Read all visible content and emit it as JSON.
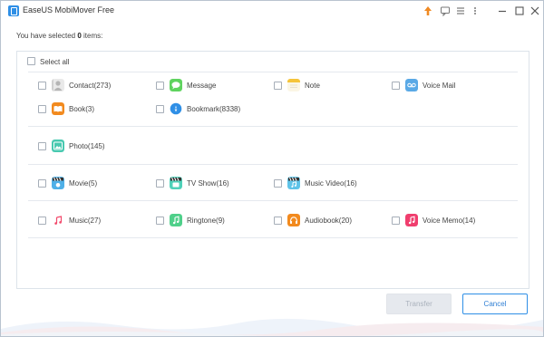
{
  "app": {
    "title": "EaseUS MobiMover Free"
  },
  "titlebar_icons": [
    "upgrade-arrow-icon",
    "feedback-icon",
    "menu-icon",
    "settings-icon",
    "minimize-icon",
    "maximize-icon",
    "close-icon"
  ],
  "selection": {
    "prefix": "You have selected ",
    "count": "0",
    "suffix": " items:"
  },
  "select_all": {
    "label": "Select all"
  },
  "categories": {
    "contact": {
      "label": "Contact(273)",
      "icon": "contact-icon"
    },
    "message": {
      "label": "Message",
      "icon": "message-icon"
    },
    "note": {
      "label": "Note",
      "icon": "note-icon"
    },
    "voice_mail": {
      "label": "Voice Mail",
      "icon": "voicemail-icon"
    },
    "book": {
      "label": "Book(3)",
      "icon": "book-icon"
    },
    "bookmark": {
      "label": "Bookmark(8338)",
      "icon": "bookmark-icon"
    },
    "photo": {
      "label": "Photo(145)",
      "icon": "photo-icon"
    },
    "movie": {
      "label": "Movie(5)",
      "icon": "movie-icon"
    },
    "tv_show": {
      "label": "TV Show(16)",
      "icon": "tv-show-icon"
    },
    "music_video": {
      "label": "Music Video(16)",
      "icon": "music-video-icon"
    },
    "music": {
      "label": "Music(27)",
      "icon": "music-icon"
    },
    "ringtone": {
      "label": "Ringtone(9)",
      "icon": "ringtone-icon"
    },
    "audiobook": {
      "label": "Audiobook(20)",
      "icon": "audiobook-icon"
    },
    "voice_memo": {
      "label": "Voice Memo(14)",
      "icon": "voice-memo-icon"
    }
  },
  "buttons": {
    "transfer": "Transfer",
    "cancel": "Cancel"
  },
  "colors": {
    "accent": "#2f8fe6",
    "disabled_bg": "#e6e9ee",
    "border": "#dde3ea",
    "upgrade": "#f08a24"
  }
}
